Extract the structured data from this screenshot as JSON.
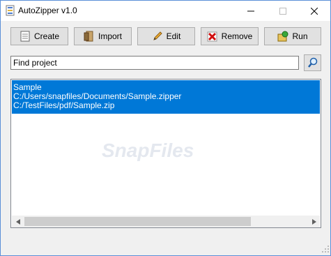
{
  "window": {
    "title": "AutoZipper v1.0"
  },
  "toolbar": {
    "create": "Create",
    "import": "Import",
    "edit": "Edit",
    "remove": "Remove",
    "run": "Run"
  },
  "search": {
    "placeholder": "Find project"
  },
  "projects": [
    {
      "name": "Sample",
      "path": "C:/Users/snapfiles/Documents/Sample.zipper",
      "target": "C:/TestFiles/pdf/Sample.zip",
      "selected": true
    }
  ],
  "watermark": "SnapFiles",
  "icons": [
    "app-icon",
    "minimize-icon",
    "maximize-icon",
    "close-icon",
    "document-icon",
    "import-icon",
    "pencil-icon",
    "red-x-icon",
    "run-icon",
    "search-icon",
    "arrow-left-icon",
    "arrow-right-icon"
  ],
  "colors": {
    "selection": "#0078d7",
    "window_border": "#5a8fd8",
    "button_bg": "#e1e1e1"
  }
}
